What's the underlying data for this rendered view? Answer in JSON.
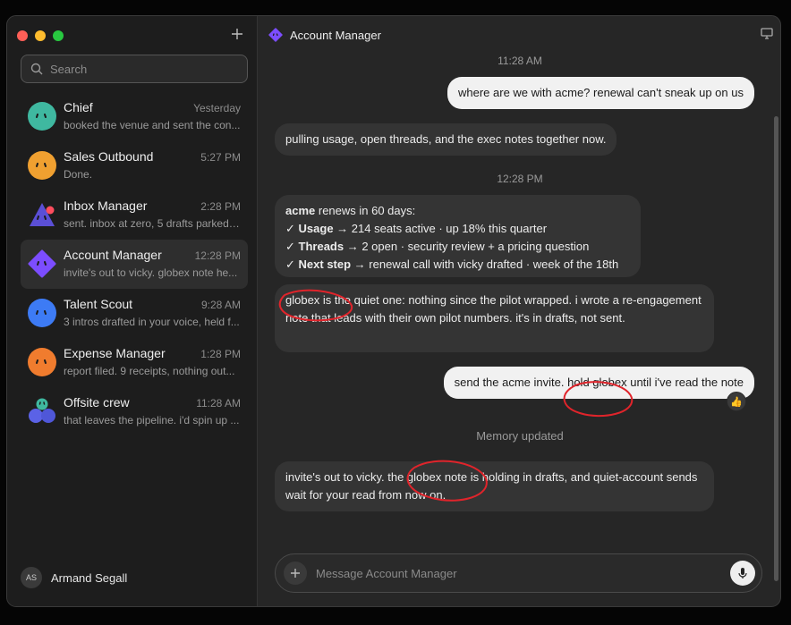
{
  "window": {
    "title": "Account Manager"
  },
  "search": {
    "placeholder": "Search"
  },
  "sidebar": {
    "conversations": [
      {
        "name": "Chief",
        "time": "Yesterday",
        "preview": "booked the venue and sent the con...",
        "avatar_color": "#3fb8a0"
      },
      {
        "name": "Sales Outbound",
        "time": "5:27 PM",
        "preview": "Done.",
        "avatar_color": "#f0a030"
      },
      {
        "name": "Inbox Manager",
        "time": "2:28 PM",
        "preview": "sent. inbox at zero, 5 drafts parked ...",
        "avatar_color": "#5b4fd6"
      },
      {
        "name": "Account Manager",
        "time": "12:28 PM",
        "preview": "invite's out to vicky. globex note he...",
        "avatar_color": "#7c4dff"
      },
      {
        "name": "Talent Scout",
        "time": "9:28 AM",
        "preview": "3 intros drafted in your voice, held f...",
        "avatar_color": "#3d7bf5"
      },
      {
        "name": "Expense Manager",
        "time": "1:28 PM",
        "preview": "report filed. 9 receipts, nothing out...",
        "avatar_color": "#f07c2e"
      },
      {
        "name": "Offsite crew",
        "time": "11:28 AM",
        "preview": "that leaves the pipeline. i'd spin up ...",
        "avatar_color": "#5b62e6"
      }
    ],
    "user": {
      "initials": "AS",
      "name": "Armand Segall"
    }
  },
  "messages": {
    "stamp1": "11:28 AM",
    "m1": "where are we with acme? renewal can't sneak up on us",
    "m2": "pulling usage, open threads, and the exec notes together now.",
    "stamp2": "12:28 PM",
    "m3": {
      "line1_bold": "acme",
      "line1_rest": " renews in 60 days:",
      "check": "✓",
      "usage_label": "Usage",
      "usage_text": " → 214 seats active · up 18% this quarter",
      "threads_label": "Threads",
      "threads_text": " → 2 open · security review + a pricing question",
      "next_label": "Next step",
      "next_text": " → renewal call with vicky drafted · week of the 18th"
    },
    "m4": "globex is the quiet one: nothing since the pilot wrapped. i wrote a re-engagement note that leads with their own pilot numbers. it's in drafts, not sent.",
    "m5": "send the acme invite. hold globex until i've read the note",
    "m5_reaction": "👍",
    "status": "Memory updated",
    "m6": "invite's out to vicky. the globex note is holding in drafts, and quiet-account sends wait for your read from now on."
  },
  "composer": {
    "placeholder": "Message Account Manager"
  },
  "colors": {
    "accent": "#7c4dff",
    "annotation": "#e0242b"
  }
}
